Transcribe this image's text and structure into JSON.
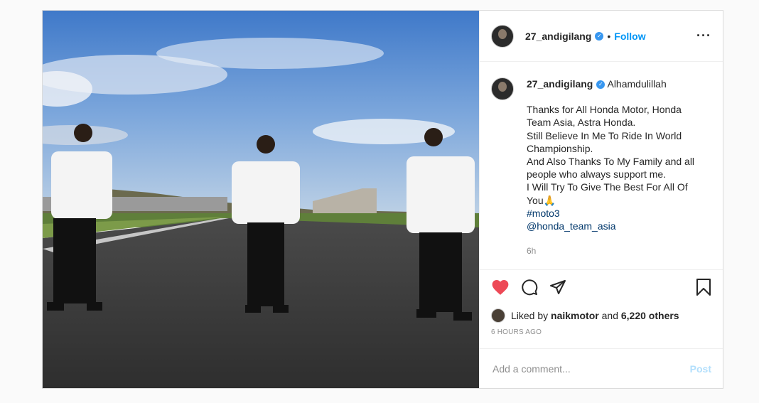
{
  "post": {
    "username": "27_andigilang",
    "separator": "•",
    "follow_label": "Follow",
    "more_icon": "more-horizontal-icon",
    "caption": {
      "username": "27_andigilang",
      "first": "Alhamdulillah",
      "lines": [
        "Thanks for All Honda Motor, Honda",
        "Team Asia, Astra Honda.",
        "Still Believe In Me To Ride In World",
        "Championship.",
        "And Also Thanks To My Family and all",
        "people who always support me.",
        "I Will Try To Give The Best For All Of",
        "You🙏"
      ],
      "hashtag": "#moto3",
      "mention": "@honda_team_asia",
      "time": "6h"
    },
    "likes": {
      "prefix": "Liked by",
      "user": "naikmotor",
      "and": "and",
      "others": "6,220 others"
    },
    "timestamp": "6 HOURS AGO",
    "comment": {
      "placeholder": "Add a comment...",
      "post_label": "Post"
    },
    "colors": {
      "like_red": "#ed4956",
      "link_blue": "#0095f6",
      "verified_blue": "#3897f0"
    }
  }
}
